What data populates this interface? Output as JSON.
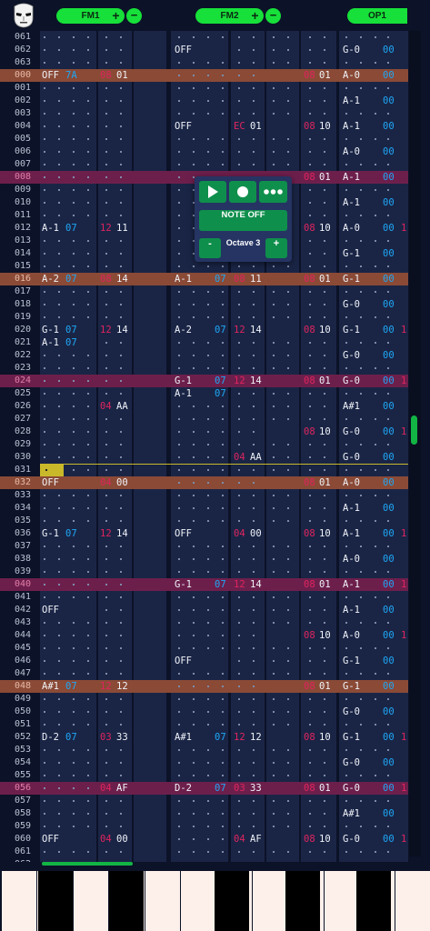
{
  "header": {
    "logo_icon": "skull-mask-icon",
    "tracks": [
      {
        "label": "FM1",
        "plus": "+",
        "minus": "−"
      },
      {
        "label": "FM2",
        "plus": "+",
        "minus": "−"
      },
      {
        "label": "OP1"
      }
    ]
  },
  "popup": {
    "play_icon": "play-icon",
    "record_icon": "record-icon",
    "more_icon": "more-dots-icon",
    "note_off_label": "NOTE OFF",
    "octave_minus": "-",
    "octave_label": "Octave 3",
    "octave_plus": "+"
  },
  "colors": {
    "background": "#0c1227",
    "column": "#1a2546",
    "row_highlight_orange": "#8a4a36",
    "row_highlight_magenta": "#6d1f4c",
    "cursor_line": "#c9b82a",
    "accent_green": "#17e03a",
    "note_blue": "#1ea7f5",
    "effect_red": "#e0245e"
  },
  "rows": [
    {
      "n": "061",
      "hl": "",
      "c": {}
    },
    {
      "n": "062",
      "hl": "",
      "c": {
        "f2n": "OFF",
        "o1n": "G-0",
        "o1i": "00"
      }
    },
    {
      "n": "063",
      "hl": "",
      "c": {}
    },
    {
      "n": "000",
      "hl": "o",
      "c": {
        "f1n": "OFF",
        "f1i": "7A",
        "f1e": "08",
        "f1v": "01",
        "f2e3": "08",
        "f2v3": "01",
        "o1n": "A-0",
        "o1i": "00"
      }
    },
    {
      "n": "001",
      "hl": "",
      "c": {}
    },
    {
      "n": "002",
      "hl": "",
      "c": {
        "o1n": "A-1",
        "o1i": "00"
      }
    },
    {
      "n": "003",
      "hl": "",
      "c": {}
    },
    {
      "n": "004",
      "hl": "",
      "c": {
        "f2n": "OFF",
        "f2e": "EC",
        "f2v": "01",
        "f2e3": "08",
        "f2v3": "10",
        "o1n": "A-1",
        "o1i": "00"
      }
    },
    {
      "n": "005",
      "hl": "",
      "c": {}
    },
    {
      "n": "006",
      "hl": "",
      "c": {
        "o1n": "A-0",
        "o1i": "00"
      }
    },
    {
      "n": "007",
      "hl": "",
      "c": {}
    },
    {
      "n": "008",
      "hl": "m",
      "c": {
        "f2e3": "08",
        "f2v3": "01",
        "o1n": "A-1",
        "o1i": "00"
      }
    },
    {
      "n": "009",
      "hl": "",
      "c": {}
    },
    {
      "n": "010",
      "hl": "",
      "c": {
        "o1n": "A-1",
        "o1i": "00"
      }
    },
    {
      "n": "011",
      "hl": "",
      "c": {}
    },
    {
      "n": "012",
      "hl": "",
      "c": {
        "f1n": "A-1",
        "f1i": "07",
        "f1e": "12",
        "f1v": "11",
        "f2e3": "08",
        "f2v3": "10",
        "o1n": "A-0",
        "o1i": "00",
        "o1x": "1"
      }
    },
    {
      "n": "013",
      "hl": "",
      "c": {}
    },
    {
      "n": "014",
      "hl": "",
      "c": {
        "o1n": "G-1",
        "o1i": "00"
      }
    },
    {
      "n": "015",
      "hl": "",
      "c": {}
    },
    {
      "n": "016",
      "hl": "o",
      "c": {
        "f1n": "A-2",
        "f1i": "07",
        "f1e": "08",
        "f1v": "14",
        "f2n": "A-1",
        "f2i": "07",
        "f2e": "08",
        "f2v": "11",
        "f2e3": "08",
        "f2v3": "01",
        "o1n": "G-1",
        "o1i": "00"
      }
    },
    {
      "n": "017",
      "hl": "",
      "c": {}
    },
    {
      "n": "018",
      "hl": "",
      "c": {
        "o1n": "G-0",
        "o1i": "00"
      }
    },
    {
      "n": "019",
      "hl": "",
      "c": {}
    },
    {
      "n": "020",
      "hl": "",
      "c": {
        "f1n": "G-1",
        "f1i": "07",
        "f1e": "12",
        "f1v": "14",
        "f2n": "A-2",
        "f2i": "07",
        "f2e": "12",
        "f2v": "14",
        "f2e3": "08",
        "f2v3": "10",
        "o1n": "G-1",
        "o1i": "00",
        "o1x": "1"
      }
    },
    {
      "n": "021",
      "hl": "",
      "c": {
        "f1n": "A-1",
        "f1i": "07"
      }
    },
    {
      "n": "022",
      "hl": "",
      "c": {
        "o1n": "G-0",
        "o1i": "00"
      }
    },
    {
      "n": "023",
      "hl": "",
      "c": {}
    },
    {
      "n": "024",
      "hl": "m",
      "c": {
        "f2n": "G-1",
        "f2i": "07",
        "f2e": "12",
        "f2v": "14",
        "f2e3": "08",
        "f2v3": "01",
        "o1n": "G-0",
        "o1i": "00",
        "o1x": "1"
      }
    },
    {
      "n": "025",
      "hl": "",
      "c": {
        "f2n": "A-1",
        "f2i": "07"
      }
    },
    {
      "n": "026",
      "hl": "",
      "c": {
        "f1e": "04",
        "f1v": "AA",
        "o1n": "A#1",
        "o1i": "00"
      }
    },
    {
      "n": "027",
      "hl": "",
      "c": {}
    },
    {
      "n": "028",
      "hl": "",
      "c": {
        "f2e3": "08",
        "f2v3": "10",
        "o1n": "G-0",
        "o1i": "00",
        "o1x": "1"
      }
    },
    {
      "n": "029",
      "hl": "",
      "c": {}
    },
    {
      "n": "030",
      "hl": "",
      "c": {
        "f2e": "04",
        "f2v": "AA",
        "o1n": "G-0",
        "o1i": "00"
      }
    },
    {
      "n": "031",
      "hl": "c",
      "c": {}
    },
    {
      "n": "032",
      "hl": "o",
      "c": {
        "f1n": "OFF",
        "f1e": "04",
        "f1v": "00",
        "f2e3": "08",
        "f2v3": "01",
        "o1n": "A-0",
        "o1i": "00"
      }
    },
    {
      "n": "033",
      "hl": "",
      "c": {}
    },
    {
      "n": "034",
      "hl": "",
      "c": {
        "o1n": "A-1",
        "o1i": "00"
      }
    },
    {
      "n": "035",
      "hl": "",
      "c": {}
    },
    {
      "n": "036",
      "hl": "",
      "c": {
        "f1n": "G-1",
        "f1i": "07",
        "f1e": "12",
        "f1v": "14",
        "f2n": "OFF",
        "f2e": "04",
        "f2v": "00",
        "f2e3": "08",
        "f2v3": "10",
        "o1n": "A-1",
        "o1i": "00",
        "o1x": "1"
      }
    },
    {
      "n": "037",
      "hl": "",
      "c": {}
    },
    {
      "n": "038",
      "hl": "",
      "c": {
        "o1n": "A-0",
        "o1i": "00"
      }
    },
    {
      "n": "039",
      "hl": "",
      "c": {}
    },
    {
      "n": "040",
      "hl": "m",
      "c": {
        "f2n": "G-1",
        "f2i": "07",
        "f2e": "12",
        "f2v": "14",
        "f2e3": "08",
        "f2v3": "01",
        "o1n": "A-1",
        "o1i": "00",
        "o1x": "1"
      }
    },
    {
      "n": "041",
      "hl": "",
      "c": {}
    },
    {
      "n": "042",
      "hl": "",
      "c": {
        "f1n": "OFF",
        "o1n": "A-1",
        "o1i": "00"
      }
    },
    {
      "n": "043",
      "hl": "",
      "c": {}
    },
    {
      "n": "044",
      "hl": "",
      "c": {
        "f2e3": "08",
        "f2v3": "10",
        "o1n": "A-0",
        "o1i": "00",
        "o1x": "1"
      }
    },
    {
      "n": "045",
      "hl": "",
      "c": {}
    },
    {
      "n": "046",
      "hl": "",
      "c": {
        "f2n": "OFF",
        "o1n": "G-1",
        "o1i": "00"
      }
    },
    {
      "n": "047",
      "hl": "",
      "c": {}
    },
    {
      "n": "048",
      "hl": "o",
      "c": {
        "f1n": "A#1",
        "f1i": "07",
        "f1e": "12",
        "f1v": "12",
        "f2e3": "08",
        "f2v3": "01",
        "o1n": "G-1",
        "o1i": "00"
      }
    },
    {
      "n": "049",
      "hl": "",
      "c": {}
    },
    {
      "n": "050",
      "hl": "",
      "c": {
        "o1n": "G-0",
        "o1i": "00"
      }
    },
    {
      "n": "051",
      "hl": "",
      "c": {}
    },
    {
      "n": "052",
      "hl": "",
      "c": {
        "f1n": "D-2",
        "f1i": "07",
        "f1e": "03",
        "f1v": "33",
        "f2n": "A#1",
        "f2i": "07",
        "f2e": "12",
        "f2v": "12",
        "f2e3": "08",
        "f2v3": "10",
        "o1n": "G-1",
        "o1i": "00",
        "o1x": "1"
      }
    },
    {
      "n": "053",
      "hl": "",
      "c": {}
    },
    {
      "n": "054",
      "hl": "",
      "c": {
        "o1n": "G-0",
        "o1i": "00"
      }
    },
    {
      "n": "055",
      "hl": "",
      "c": {}
    },
    {
      "n": "056",
      "hl": "m",
      "c": {
        "f1e": "04",
        "f1v": "AF",
        "f2n": "D-2",
        "f2i": "07",
        "f2e": "03",
        "f2v": "33",
        "f2e3": "08",
        "f2v3": "01",
        "o1n": "G-0",
        "o1i": "00",
        "o1x": "1"
      }
    },
    {
      "n": "057",
      "hl": "",
      "c": {}
    },
    {
      "n": "058",
      "hl": "",
      "c": {
        "o1n": "A#1",
        "o1i": "00"
      }
    },
    {
      "n": "059",
      "hl": "",
      "c": {}
    },
    {
      "n": "060",
      "hl": "",
      "c": {
        "f1n": "OFF",
        "f1e": "04",
        "f1v": "00",
        "f2e": "04",
        "f2v": "AF",
        "f2e3": "08",
        "f2v3": "10",
        "o1n": "G-0",
        "o1i": "00",
        "o1x": "1"
      }
    },
    {
      "n": "061",
      "hl": "",
      "c": {}
    },
    {
      "n": "062",
      "hl": "",
      "c": {}
    }
  ]
}
